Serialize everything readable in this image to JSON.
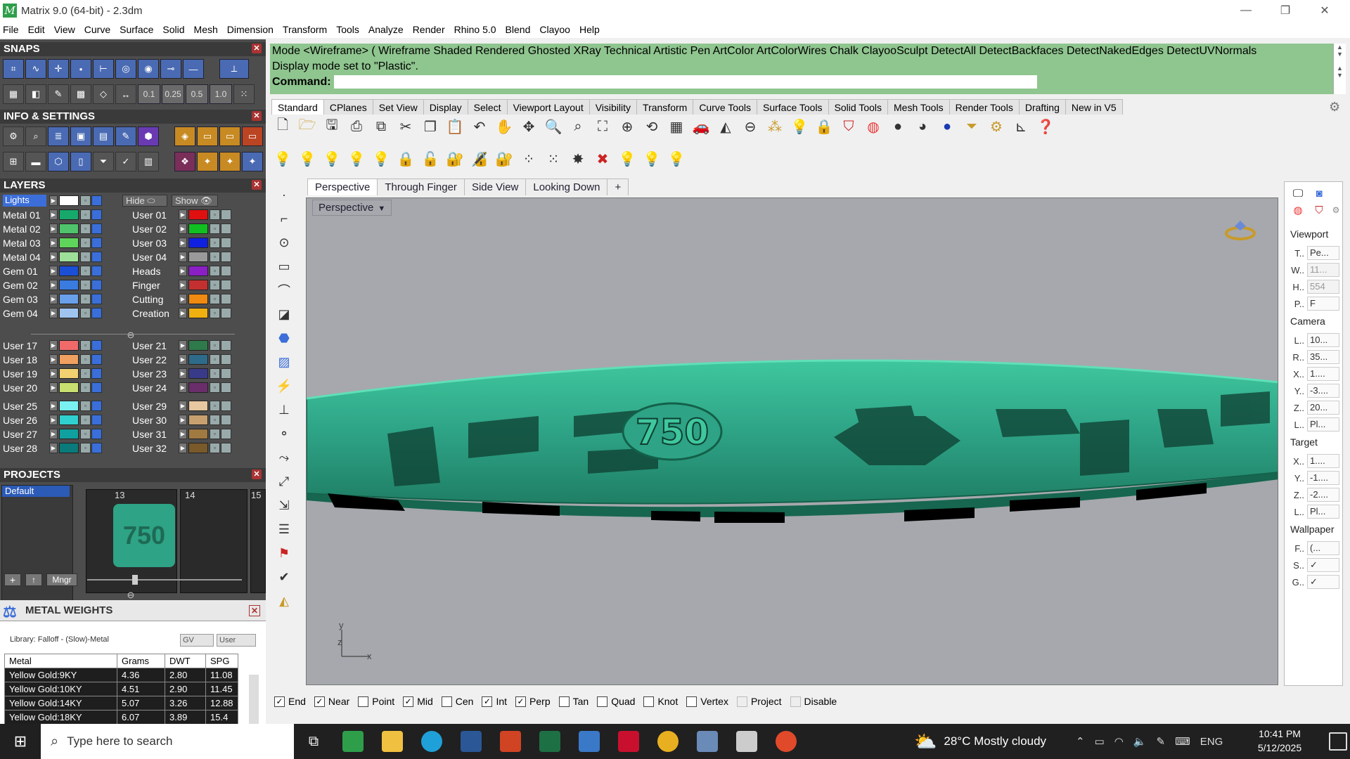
{
  "window": {
    "title": "Matrix 9.0 (64-bit) - 2.3dm",
    "minimize": "—",
    "restore": "❐",
    "close": "✕"
  },
  "menubar": [
    "File",
    "Edit",
    "View",
    "Curve",
    "Surface",
    "Solid",
    "Mesh",
    "Dimension",
    "Transform",
    "Tools",
    "Analyze",
    "Render",
    "Rhino 5.0",
    "Blend",
    "Clayoo",
    "Help"
  ],
  "left": {
    "snaps_title": "SNAPS",
    "snap_values": [
      "0.1",
      "0.25",
      "0.5",
      "1.0"
    ],
    "info_title": "INFO & SETTINGS",
    "layers_title": "LAYERS",
    "layers_header": {
      "lights": "Lights",
      "hide": "Hide",
      "show": "Show"
    },
    "layer_groups": [
      {
        "left": [
          {
            "name": "Metal 01",
            "color": "#17a86b"
          },
          {
            "name": "Metal 02",
            "color": "#4fc46c"
          },
          {
            "name": "Metal 03",
            "color": "#5fd45a"
          },
          {
            "name": "Metal 04",
            "color": "#9ee09a"
          }
        ],
        "right": [
          {
            "name": "User 01",
            "color": "#e01010"
          },
          {
            "name": "User 02",
            "color": "#10c020"
          },
          {
            "name": "User 03",
            "color": "#1020e0"
          },
          {
            "name": "User 04",
            "color": "#9a9a9a"
          }
        ]
      },
      {
        "left": [
          {
            "name": "Gem 01",
            "color": "#1a4fd6"
          },
          {
            "name": "Gem 02",
            "color": "#3a7be0"
          },
          {
            "name": "Gem 03",
            "color": "#6aa0ea"
          },
          {
            "name": "Gem 04",
            "color": "#a0c4f0"
          }
        ],
        "right": [
          {
            "name": "Heads",
            "color": "#8a1fc4"
          },
          {
            "name": "Finger",
            "color": "#c43030"
          },
          {
            "name": "Cutting",
            "color": "#f08a10"
          },
          {
            "name": "Creation",
            "color": "#f0b010"
          }
        ]
      },
      {
        "left": [
          {
            "name": "User 17",
            "color": "#f06a6a"
          },
          {
            "name": "User 18",
            "color": "#f0a060"
          },
          {
            "name": "User 19",
            "color": "#f0d070"
          },
          {
            "name": "User 20",
            "color": "#c8e070"
          }
        ],
        "right": [
          {
            "name": "User 21",
            "color": "#2e7a4a"
          },
          {
            "name": "User 22",
            "color": "#2e6a8a"
          },
          {
            "name": "User 23",
            "color": "#3a3a8a"
          },
          {
            "name": "User 24",
            "color": "#6a2e6a"
          }
        ]
      },
      {
        "left": [
          {
            "name": "User 25",
            "color": "#7af0f0"
          },
          {
            "name": "User 26",
            "color": "#30d0d0"
          },
          {
            "name": "User 27",
            "color": "#10a0a0"
          },
          {
            "name": "User 28",
            "color": "#0a7a7a"
          }
        ],
        "right": [
          {
            "name": "User 29",
            "color": "#e8c8a0"
          },
          {
            "name": "User 30",
            "color": "#c8a070"
          },
          {
            "name": "User 31",
            "color": "#a07a40"
          },
          {
            "name": "User 32",
            "color": "#7a5a2a"
          }
        ]
      }
    ],
    "projects_title": "PROJECTS",
    "projects": {
      "default": "Default",
      "slots": [
        "13",
        "14",
        "15"
      ],
      "mngr": "Mngr",
      "add": "+",
      "up": "↑",
      "slot_preview_text": "750"
    },
    "metal_weights": {
      "title": "METAL WEIGHTS",
      "library": "Library: Falloff - (Slow)-Metal",
      "gv": "GV",
      "user": "User",
      "columns": [
        "Metal",
        "Grams",
        "DWT",
        "SPG"
      ],
      "rows": [
        [
          "Yellow Gold:9KY",
          "4.36",
          "2.80",
          "11.08"
        ],
        [
          "Yellow Gold:10KY",
          "4.51",
          "2.90",
          "11.45"
        ],
        [
          "Yellow Gold:14KY",
          "5.07",
          "3.26",
          "12.88"
        ],
        [
          "Yellow Gold:18KY",
          "6.07",
          "3.89",
          "15.4"
        ]
      ]
    }
  },
  "command": {
    "line1": "Mode <Wireframe> ( Wireframe  Shaded  Rendered  Ghosted  XRay  Technical  Artistic  Pen  ArtColor  ArtColorWires  Chalk  ClayooSculpt  DetectAll  DetectBackfaces  DetectNakedEdges  DetectUVNormals",
    "line2": "Display mode set to \"Plastic\".",
    "prompt": "Command:"
  },
  "toolbar_tabs": [
    "Standard",
    "CPlanes",
    "Set View",
    "Display",
    "Select",
    "Viewport Layout",
    "Visibility",
    "Transform",
    "Curve Tools",
    "Surface Tools",
    "Solid Tools",
    "Mesh Tools",
    "Render Tools",
    "Drafting",
    "New in V5"
  ],
  "viewport_tabs": [
    "Perspective",
    "Through Finger",
    "Side View",
    "Looking Down",
    "+"
  ],
  "viewport": {
    "label": "Perspective",
    "dropdown": "▼",
    "ring_text": "750",
    "axis_y": "y",
    "axis_z": "z",
    "axis_x": "x"
  },
  "properties": {
    "viewport_section": "Viewport",
    "viewport_rows": [
      [
        "T..",
        "Pe..."
      ],
      [
        "W..",
        "11..."
      ],
      [
        "H..",
        "554"
      ],
      [
        "P..",
        "F"
      ]
    ],
    "camera_section": "Camera",
    "camera_rows": [
      [
        "L..",
        "10..."
      ],
      [
        "R..",
        "35..."
      ],
      [
        "X..",
        "1...."
      ],
      [
        "Y..",
        "-3...."
      ],
      [
        "Z..",
        "20..."
      ],
      [
        "L..",
        "Pl..."
      ]
    ],
    "target_section": "Target",
    "target_rows": [
      [
        "X..",
        "1...."
      ],
      [
        "Y..",
        "-1...."
      ],
      [
        "Z..",
        "-2...."
      ],
      [
        "L..",
        "Pl..."
      ]
    ],
    "wallpaper_section": "Wallpaper",
    "wallpaper_rows": [
      [
        "F..",
        "(..."
      ],
      [
        "S..",
        "✓"
      ],
      [
        "G..",
        "✓"
      ]
    ]
  },
  "snaps": [
    {
      "label": "End",
      "checked": true
    },
    {
      "label": "Near",
      "checked": true
    },
    {
      "label": "Point",
      "checked": false
    },
    {
      "label": "Mid",
      "checked": true
    },
    {
      "label": "Cen",
      "checked": false
    },
    {
      "label": "Int",
      "checked": true
    },
    {
      "label": "Perp",
      "checked": true
    },
    {
      "label": "Tan",
      "checked": false
    },
    {
      "label": "Quad",
      "checked": false
    },
    {
      "label": "Knot",
      "checked": false
    },
    {
      "label": "Vertex",
      "checked": false
    },
    {
      "label": "Project",
      "checked": false
    },
    {
      "label": "Disable",
      "checked": false
    }
  ],
  "taskbar": {
    "search_placeholder": "Type here to search",
    "weather": "28°C  Mostly cloudy",
    "language": "ENG",
    "time": "10:41 PM",
    "date": "5/12/2025"
  },
  "colors": {
    "accent": "#2ea386",
    "command_bg": "#8fc58f",
    "panel_bg": "#4d4d4d",
    "viewport_bg": "#a6a8ad"
  }
}
